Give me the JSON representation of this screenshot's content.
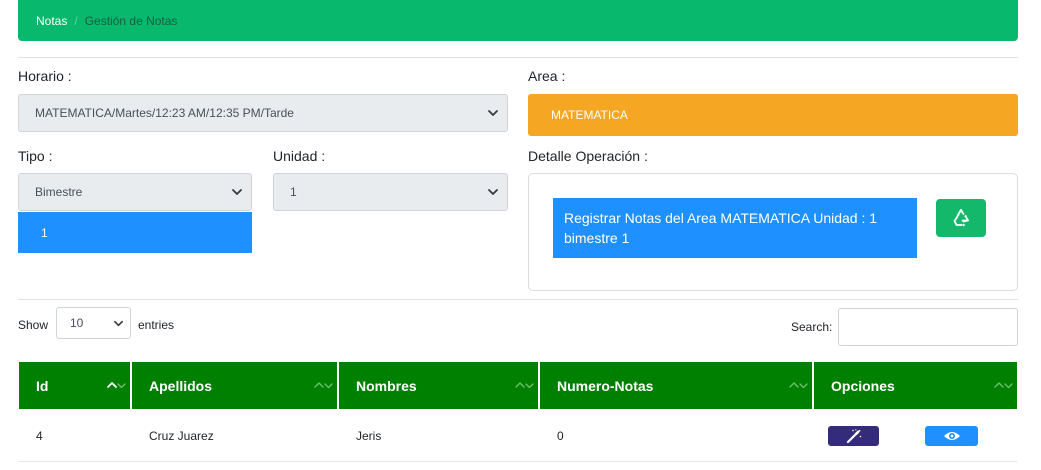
{
  "breadcrumb": {
    "root": "Notas",
    "separator": "/",
    "current": "Gestión de Notas"
  },
  "form": {
    "horario": {
      "label": "Horario :",
      "value": "MATEMATICA/Martes/12:23 AM/12:35 PM/Tarde"
    },
    "area": {
      "label": "Area :",
      "value": "MATEMATICA"
    },
    "tipo": {
      "label": "Tipo :",
      "value": "Bimestre",
      "open_option": "1"
    },
    "unidad": {
      "label": "Unidad :",
      "value": "1"
    },
    "detalle": {
      "label": "Detalle Operación :",
      "info": "Registrar Notas del Area MATEMATICA Unidad : 1 bimestre 1",
      "action_icon": "recycle-icon"
    }
  },
  "table_controls": {
    "show_label": "Show",
    "entries_value": "10",
    "entries_label": "entries",
    "search_label": "Search:",
    "search_value": ""
  },
  "table": {
    "columns": [
      "Id",
      "Apellidos",
      "Nombres",
      "Numero-Notas",
      "Opciones"
    ],
    "rows": [
      {
        "id": "4",
        "apellidos": "Cruz Juarez",
        "nombres": "Jeris",
        "numero_notas": "0",
        "actions": [
          "magic-wand-icon",
          "eye-icon"
        ]
      }
    ]
  },
  "colors": {
    "header_green": "#08b86d",
    "table_green": "#008000",
    "area_orange": "#f5a623",
    "info_blue": "#1e90ff",
    "edit_purple": "#342b7a"
  }
}
